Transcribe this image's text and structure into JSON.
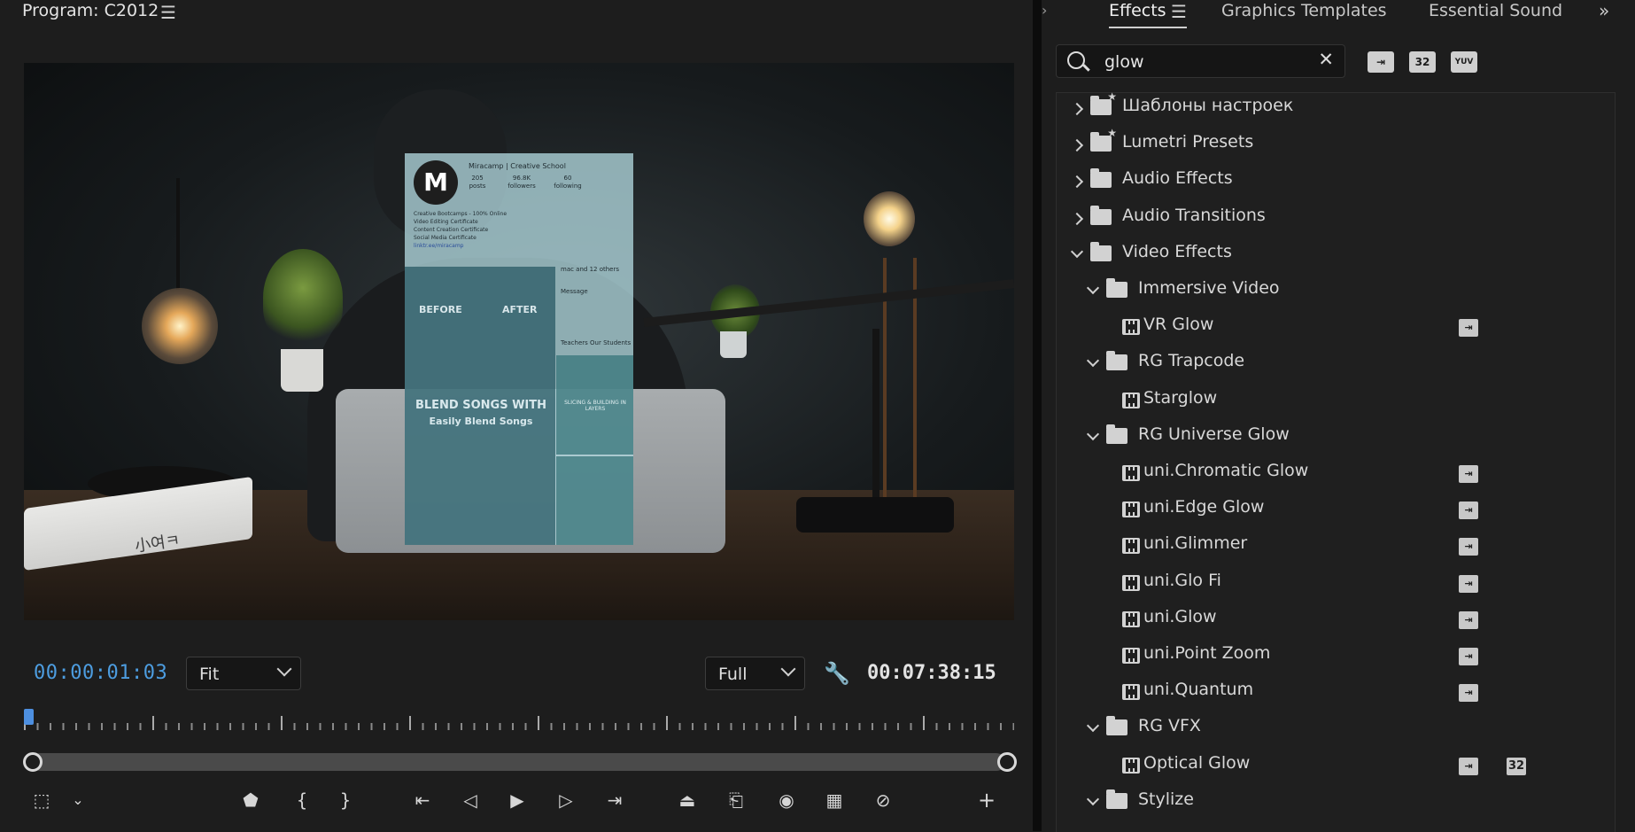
{
  "program": {
    "title": "Program: C2012",
    "menu_icon": "hamburger-icon",
    "current_timecode": "00:00:01:03",
    "duration_timecode": "00:07:38:15",
    "zoom": "Fit",
    "resolution": "Full",
    "video_frame": {
      "book_text": "小여ㅋ",
      "overlay": {
        "logo_letter": "M",
        "account_name": "Miracamp | Creative School",
        "stats": [
          {
            "value": "205",
            "label": "posts"
          },
          {
            "value": "96.8K",
            "label": "followers"
          },
          {
            "value": "60",
            "label": "following"
          }
        ],
        "bio": [
          "Creative Bootcamps - 100% Online",
          "Video Editing Certificate",
          "Content Creation Certificate",
          "Social Media Certificate"
        ],
        "link": "linktr.ee/miracamp",
        "before": "BEFORE",
        "after": "AFTER",
        "blend_line1": "BLEND SONGS WITH",
        "blend_line2": "Easily Blend Songs",
        "followers_note": "mac and 12 others",
        "message": "Message",
        "stories": "Teachers  Our Students",
        "thumb_text": "SLICING & BUILDING IN LAYERS"
      }
    },
    "transport_icons": [
      "safe-margins-icon",
      "settings-chevron-icon",
      "marker-icon",
      "mark-in-icon",
      "mark-out-icon",
      "go-to-in-icon",
      "step-back-icon",
      "play-icon",
      "step-forward-icon",
      "go-to-out-icon",
      "lift-icon",
      "extract-icon",
      "export-frame-icon",
      "comparison-view-icon",
      "proxy-toggle-icon",
      "add-button-icon"
    ]
  },
  "effects_panel": {
    "tabs": [
      {
        "label": "Effects",
        "active": true
      },
      {
        "label": "Graphics Templates",
        "active": false
      },
      {
        "label": "Essential Sound",
        "active": false
      }
    ],
    "search": {
      "value": "glow",
      "placeholder": ""
    },
    "filters": [
      {
        "name": "accelerated-effects-filter",
        "label": ""
      },
      {
        "name": "32bit-filter",
        "label": "32"
      },
      {
        "name": "yuv-filter",
        "label": "YUV"
      }
    ],
    "tree": [
      {
        "label": "Шаблоны настроек",
        "level": 0,
        "type": "preset-folder",
        "expanded": false
      },
      {
        "label": "Lumetri Presets",
        "level": 0,
        "type": "preset-folder",
        "expanded": false
      },
      {
        "label": "Audio Effects",
        "level": 0,
        "type": "folder",
        "expanded": false
      },
      {
        "label": "Audio Transitions",
        "level": 0,
        "type": "folder",
        "expanded": false
      },
      {
        "label": "Video Effects",
        "level": 0,
        "type": "folder",
        "expanded": true
      },
      {
        "label": "Immersive Video",
        "level": 1,
        "type": "folder",
        "expanded": true
      },
      {
        "label": "VR Glow",
        "level": 2,
        "type": "effect",
        "accelerated": true,
        "bit32": false
      },
      {
        "label": "RG Trapcode",
        "level": 1,
        "type": "folder",
        "expanded": true
      },
      {
        "label": "Starglow",
        "level": 2,
        "type": "effect",
        "accelerated": false,
        "bit32": false
      },
      {
        "label": "RG Universe Glow",
        "level": 1,
        "type": "folder",
        "expanded": true
      },
      {
        "label": "uni.Chromatic Glow",
        "level": 2,
        "type": "effect",
        "accelerated": true,
        "bit32": false
      },
      {
        "label": "uni.Edge Glow",
        "level": 2,
        "type": "effect",
        "accelerated": true,
        "bit32": false
      },
      {
        "label": "uni.Glimmer",
        "level": 2,
        "type": "effect",
        "accelerated": true,
        "bit32": false
      },
      {
        "label": "uni.Glo Fi",
        "level": 2,
        "type": "effect",
        "accelerated": true,
        "bit32": false
      },
      {
        "label": "uni.Glow",
        "level": 2,
        "type": "effect",
        "accelerated": true,
        "bit32": false
      },
      {
        "label": "uni.Point Zoom",
        "level": 2,
        "type": "effect",
        "accelerated": true,
        "bit32": false
      },
      {
        "label": "uni.Quantum",
        "level": 2,
        "type": "effect",
        "accelerated": true,
        "bit32": false
      },
      {
        "label": "RG VFX",
        "level": 1,
        "type": "folder",
        "expanded": true
      },
      {
        "label": "Optical Glow",
        "level": 2,
        "type": "effect",
        "accelerated": true,
        "bit32": true
      },
      {
        "label": "Stylize",
        "level": 1,
        "type": "folder",
        "expanded": true
      }
    ]
  }
}
